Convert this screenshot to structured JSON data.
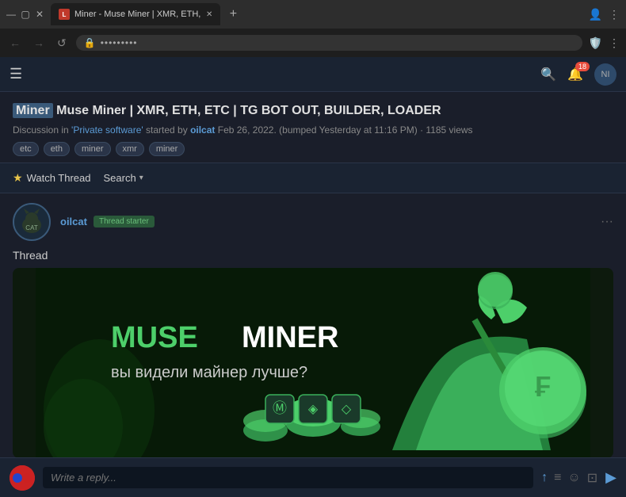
{
  "browser": {
    "tab_title": "Miner - Muse Miner | XMR, ETH,...",
    "tab_favicon": "L",
    "url_placeholder": "•••••••••",
    "new_tab_symbol": "+",
    "nav": {
      "back": "←",
      "forward": "→",
      "refresh": "↺",
      "menu": "⋮"
    }
  },
  "topnav": {
    "hamburger": "☰",
    "search_icon": "🔍",
    "notification_badge": "18",
    "user_initials": "NI"
  },
  "thread": {
    "title_highlight": "Miner",
    "title_rest": "Muse Miner | XMR, ETH, ETC | TG BOT OUT, BUILDER, LOADER",
    "meta_prefix": "Discussion in",
    "category": "'Private software'",
    "meta_middle": "started by",
    "author": "oilcat",
    "date": "Feb 26, 2022.",
    "bumped": "(bumped Yesterday at 11:16 PM)",
    "separator": "·",
    "views": "1185 views",
    "tags": [
      "etc",
      "eth",
      "miner",
      "xmr",
      "miner"
    ]
  },
  "actions": {
    "watch_label": "Watch Thread",
    "search_label": "Search",
    "star": "★"
  },
  "post": {
    "username": "oilcat",
    "badge": "Thread starter",
    "more_icon": "···",
    "thread_label": "Thread",
    "banner_title_main": "MUSE MINER",
    "banner_subtitle": "вы видели майнер лучше?"
  },
  "reply_bar": {
    "placeholder": "Write a reply...",
    "icons": {
      "up_arrow": "↑",
      "list": "≡",
      "emoji": "☺",
      "image": "⊡",
      "send": "▶"
    }
  }
}
